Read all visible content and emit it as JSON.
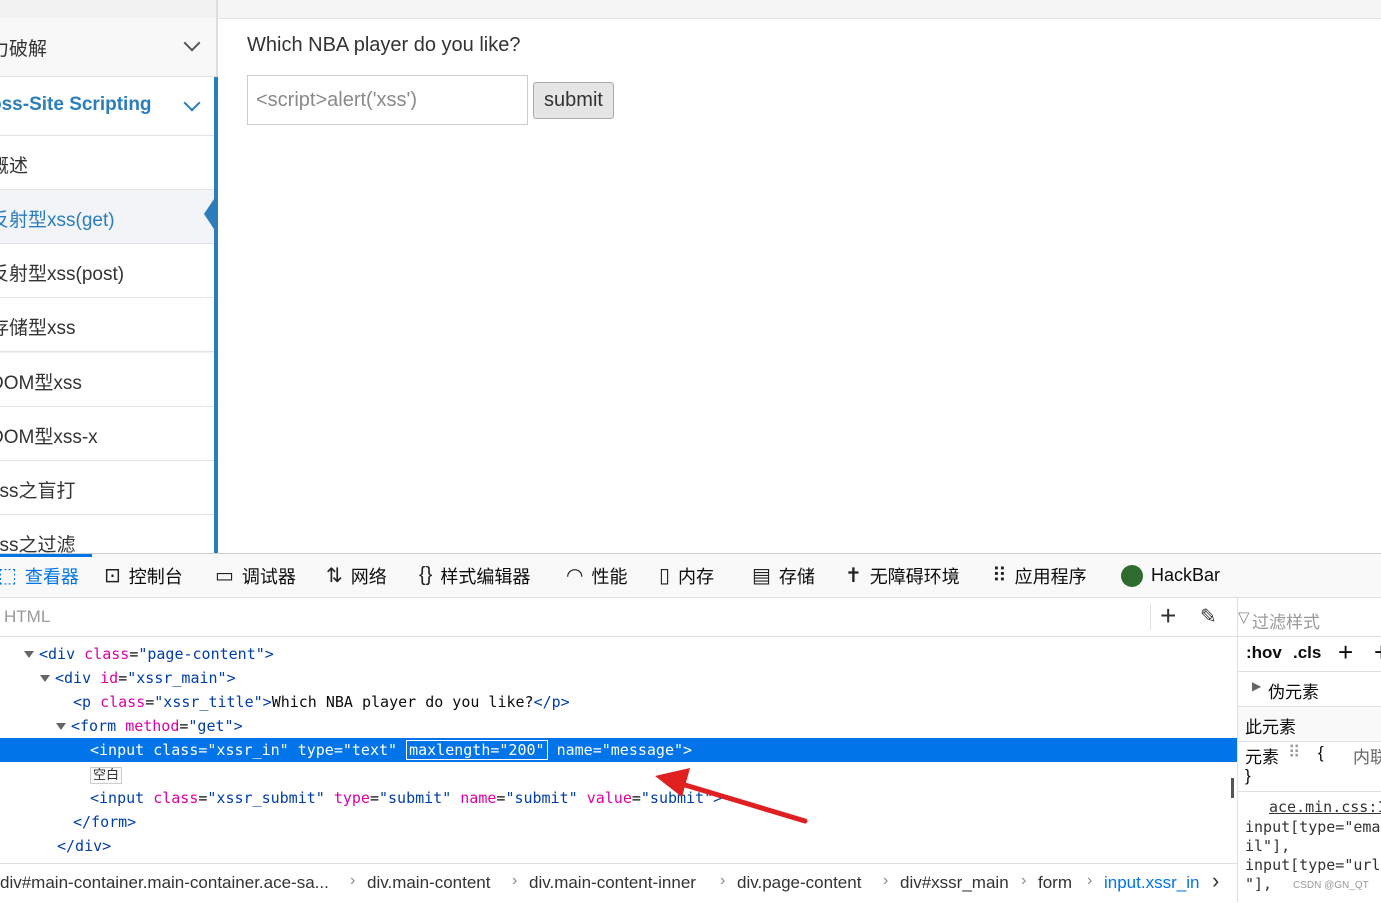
{
  "sidebar": {
    "items": [
      {
        "label": "力破解",
        "type": "group"
      },
      {
        "label": "oss-Site Scripting",
        "type": "group-open"
      },
      {
        "label": "概述"
      },
      {
        "label": "反射型xss(get)",
        "active": true
      },
      {
        "label": "反射型xss(post)"
      },
      {
        "label": "存储型xss"
      },
      {
        "label": "DOM型xss"
      },
      {
        "label": "DOM型xss-x"
      },
      {
        "label": "xss之盲打"
      },
      {
        "label": "xss之过滤"
      }
    ]
  },
  "main": {
    "question": "Which NBA player do you like?",
    "input_placeholder": "<script>alert('xss')",
    "submit_label": "submit"
  },
  "devtools": {
    "tabs": [
      {
        "label": "查看器",
        "icon": "inspector-icon",
        "selected": true
      },
      {
        "label": "控制台",
        "icon": "console-icon"
      },
      {
        "label": "调试器",
        "icon": "debugger-icon"
      },
      {
        "label": "网络",
        "icon": "network-icon"
      },
      {
        "label": "样式编辑器",
        "icon": "style-editor-icon"
      },
      {
        "label": "性能",
        "icon": "performance-icon"
      },
      {
        "label": "内存",
        "icon": "memory-icon"
      },
      {
        "label": "存储",
        "icon": "storage-icon"
      },
      {
        "label": "无障碍环境",
        "icon": "accessibility-icon"
      },
      {
        "label": "应用程序",
        "icon": "application-icon"
      },
      {
        "label": "HackBar",
        "icon": "hackbar-icon"
      }
    ],
    "search_placeholder": "HTML",
    "markup": {
      "l1_tag_open": "<div ",
      "l1_attr": "class",
      "l1_val": "\"page-content\"",
      "l2_attr": "id",
      "l2_val": "\"xssr_main\"",
      "l3_attr": "class",
      "l3_val": "\"xssr_title\"",
      "l3_text": "Which NBA player do you like?",
      "l4_attr": "method",
      "l4_val": "\"get\"",
      "l5_class_val": "\"xssr_in\"",
      "l5_type_val": "\"text\"",
      "l5_maxlength": "maxlength=\"200\"",
      "l5_name_val": "\"message\"",
      "empty_badge": "空白",
      "l7_class_val": "\"xssr_submit\"",
      "l7_type_val": "\"submit\"",
      "l7_name_val": "\"submit\"",
      "l7_value_val": "\"submit\""
    },
    "breadcrumbs": [
      "div#main-container.main-container.ace-sa...",
      "div.main-content",
      "div.main-content-inner",
      "div.page-content",
      "div#xssr_main",
      "form",
      "input.xssr_in"
    ],
    "rules": {
      "filter_placeholder": "过滤样式",
      "hov": ":hov",
      "cls": ".cls",
      "pseudo_elements": "伪元素",
      "this_element": "此元素",
      "element_label": "元素",
      "inline": "内联",
      "stylesheet": "ace.min.css:1",
      "selector_lines": [
        "input[type=\"ema",
        "il\"],",
        "input[type=\"url",
        "\"],"
      ]
    }
  },
  "watermark": "CSDN @GN_QT"
}
